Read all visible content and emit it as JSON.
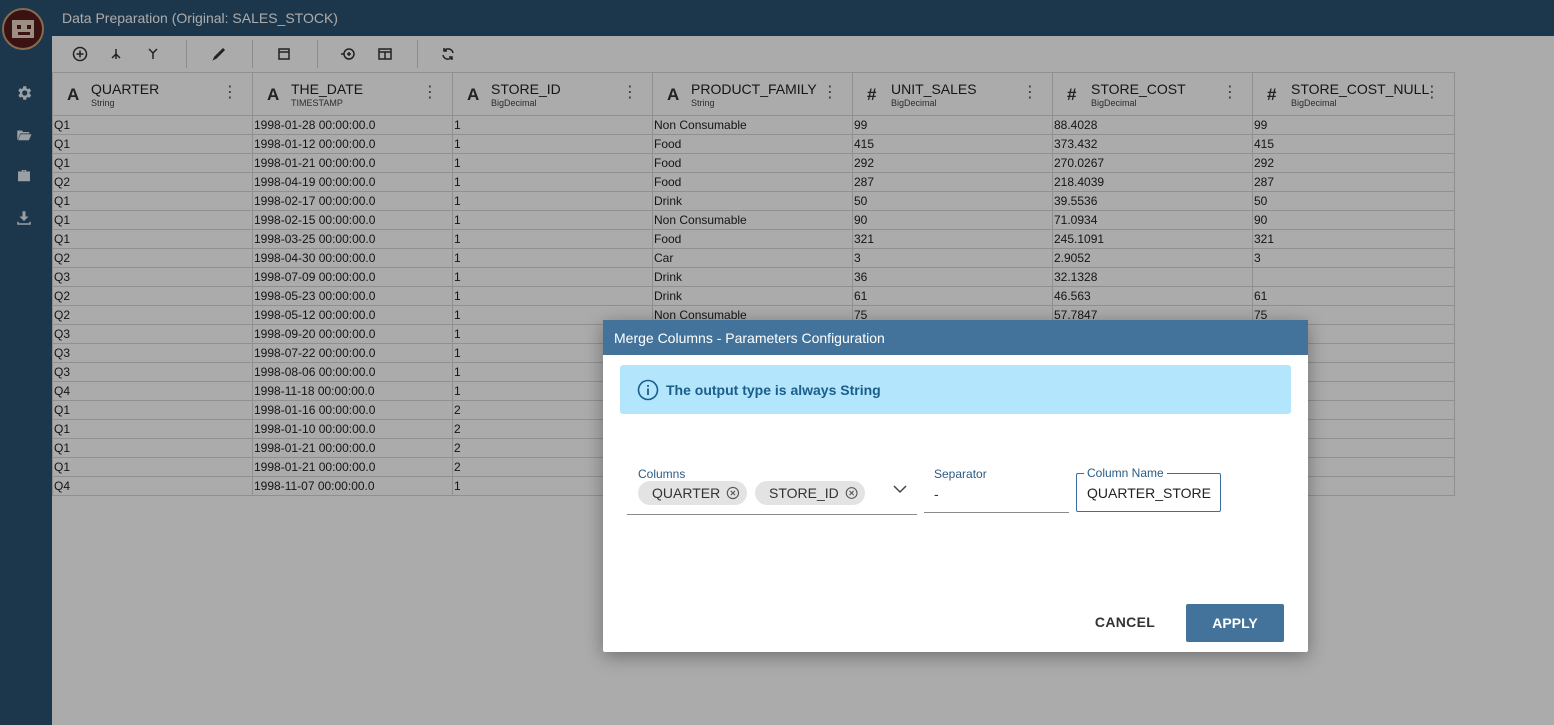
{
  "app": {
    "title": "Data Preparation (Original: SALES_STOCK)",
    "accent_color": "#2b5272"
  },
  "sidebar": {
    "items": [
      {
        "icon": "gear-icon"
      },
      {
        "icon": "folder-open-icon"
      },
      {
        "icon": "briefcase-icon"
      },
      {
        "icon": "download-icon"
      }
    ]
  },
  "toolbar": {
    "buttons": [
      "add-icon",
      "merge-icon",
      "split-icon",
      "edit-icon",
      "box-icon",
      "add-column-icon",
      "table-icon",
      "refresh-icon"
    ]
  },
  "grid": {
    "columns": [
      {
        "name": "QUARTER",
        "type": "String",
        "icon": "A"
      },
      {
        "name": "THE_DATE",
        "type": "TIMESTAMP",
        "icon": "A"
      },
      {
        "name": "STORE_ID",
        "type": "BigDecimal",
        "icon": "A"
      },
      {
        "name": "PRODUCT_FAMILY",
        "type": "String",
        "icon": "A"
      },
      {
        "name": "UNIT_SALES",
        "type": "BigDecimal",
        "icon": "#"
      },
      {
        "name": "STORE_COST",
        "type": "BigDecimal",
        "icon": "#"
      },
      {
        "name": "STORE_COST_NULL",
        "type": "BigDecimal",
        "icon": "#"
      }
    ],
    "rows": [
      [
        "Q1",
        "1998-01-28 00:00:00.0",
        "1",
        "Non Consumable",
        "99",
        "88.4028",
        "99"
      ],
      [
        "Q1",
        "1998-01-12 00:00:00.0",
        "1",
        "Food",
        "415",
        "373.432",
        "415"
      ],
      [
        "Q1",
        "1998-01-21 00:00:00.0",
        "1",
        "Food",
        "292",
        "270.0267",
        "292"
      ],
      [
        "Q2",
        "1998-04-19 00:00:00.0",
        "1",
        "Food",
        "287",
        "218.4039",
        "287"
      ],
      [
        "Q1",
        "1998-02-17 00:00:00.0",
        "1",
        "Drink",
        "50",
        "39.5536",
        "50"
      ],
      [
        "Q1",
        "1998-02-15 00:00:00.0",
        "1",
        "Non Consumable",
        "90",
        "71.0934",
        "90"
      ],
      [
        "Q1",
        "1998-03-25 00:00:00.0",
        "1",
        "Food",
        "321",
        "245.1091",
        "321"
      ],
      [
        "Q2",
        "1998-04-30 00:00:00.0",
        "1",
        "Car",
        "3",
        "2.9052",
        "3"
      ],
      [
        "Q3",
        "1998-07-09 00:00:00.0",
        "1",
        "Drink",
        "36",
        "32.1328",
        ""
      ],
      [
        "Q2",
        "1998-05-23 00:00:00.0",
        "1",
        "Drink",
        "61",
        "46.563",
        "61"
      ],
      [
        "Q2",
        "1998-05-12 00:00:00.0",
        "1",
        "Non Consumable",
        "75",
        "57.7847",
        "75"
      ],
      [
        "Q3",
        "1998-09-20 00:00:00.0",
        "1",
        "",
        "",
        "",
        ""
      ],
      [
        "Q3",
        "1998-07-22 00:00:00.0",
        "1",
        "",
        "",
        "",
        ""
      ],
      [
        "Q3",
        "1998-08-06 00:00:00.0",
        "1",
        "",
        "",
        "",
        ""
      ],
      [
        "Q4",
        "1998-11-18 00:00:00.0",
        "1",
        "",
        "",
        "",
        ""
      ],
      [
        "Q1",
        "1998-01-16 00:00:00.0",
        "2",
        "",
        "",
        "",
        ""
      ],
      [
        "Q1",
        "1998-01-10 00:00:00.0",
        "2",
        "",
        "",
        "",
        ""
      ],
      [
        "Q1",
        "1998-01-21 00:00:00.0",
        "2",
        "",
        "",
        "",
        ""
      ],
      [
        "Q1",
        "1998-01-21 00:00:00.0",
        "2",
        "",
        "",
        "",
        ""
      ],
      [
        "Q4",
        "1998-11-07 00:00:00.0",
        "1",
        "",
        "",
        "",
        ""
      ]
    ]
  },
  "dialog": {
    "title": "Merge Columns - Parameters Configuration",
    "info_text": "The output type is always String",
    "columns_label": "Columns",
    "selected_columns": [
      "QUARTER",
      "STORE_ID"
    ],
    "separator_label": "Separator",
    "separator_value": "-",
    "column_name_label": "Column Name",
    "column_name_value": "QUARTER_STORE",
    "cancel_label": "CANCEL",
    "apply_label": "APPLY",
    "header_color": "#43739b",
    "info_bg_color": "#b3e5fc"
  }
}
